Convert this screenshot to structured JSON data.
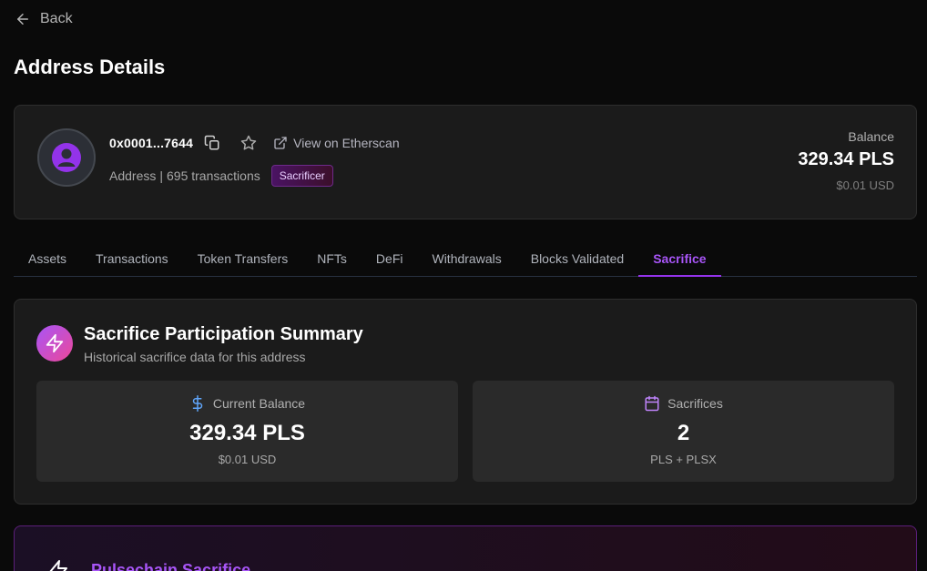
{
  "nav": {
    "back_label": "Back"
  },
  "page": {
    "title": "Address Details"
  },
  "address": {
    "short": "0x0001...7644",
    "view_link": "View on Etherscan",
    "type": "Address",
    "separator": "|",
    "tx_count": "695 transactions",
    "badge": "Sacrificer"
  },
  "balance": {
    "label": "Balance",
    "value": "329.34 PLS",
    "usd": "$0.01 USD"
  },
  "tabs": [
    {
      "label": "Assets"
    },
    {
      "label": "Transactions"
    },
    {
      "label": "Token Transfers"
    },
    {
      "label": "NFTs"
    },
    {
      "label": "DeFi"
    },
    {
      "label": "Withdrawals"
    },
    {
      "label": "Blocks Validated"
    },
    {
      "label": "Sacrifice",
      "active": true
    }
  ],
  "summary": {
    "title": "Sacrifice Participation Summary",
    "subtitle": "Historical sacrifice data for this address",
    "current_balance": {
      "label": "Current Balance",
      "value": "329.34 PLS",
      "sub": "$0.01 USD",
      "icon": "dollar-icon"
    },
    "sacrifices": {
      "label": "Sacrifices",
      "value": "2",
      "sub": "PLS + PLSX",
      "icon": "calendar-icon"
    }
  },
  "pulsechain": {
    "title": "Pulsechain Sacrifice",
    "icon": "zap-icon"
  },
  "colors": {
    "background": "#0a0a0a",
    "card": "#1b1b1b",
    "accent": "#a855f7",
    "accent_gradient_end": "#ec4899",
    "stat_blue": "#60a5fa",
    "stat_purple": "#c084fc"
  }
}
